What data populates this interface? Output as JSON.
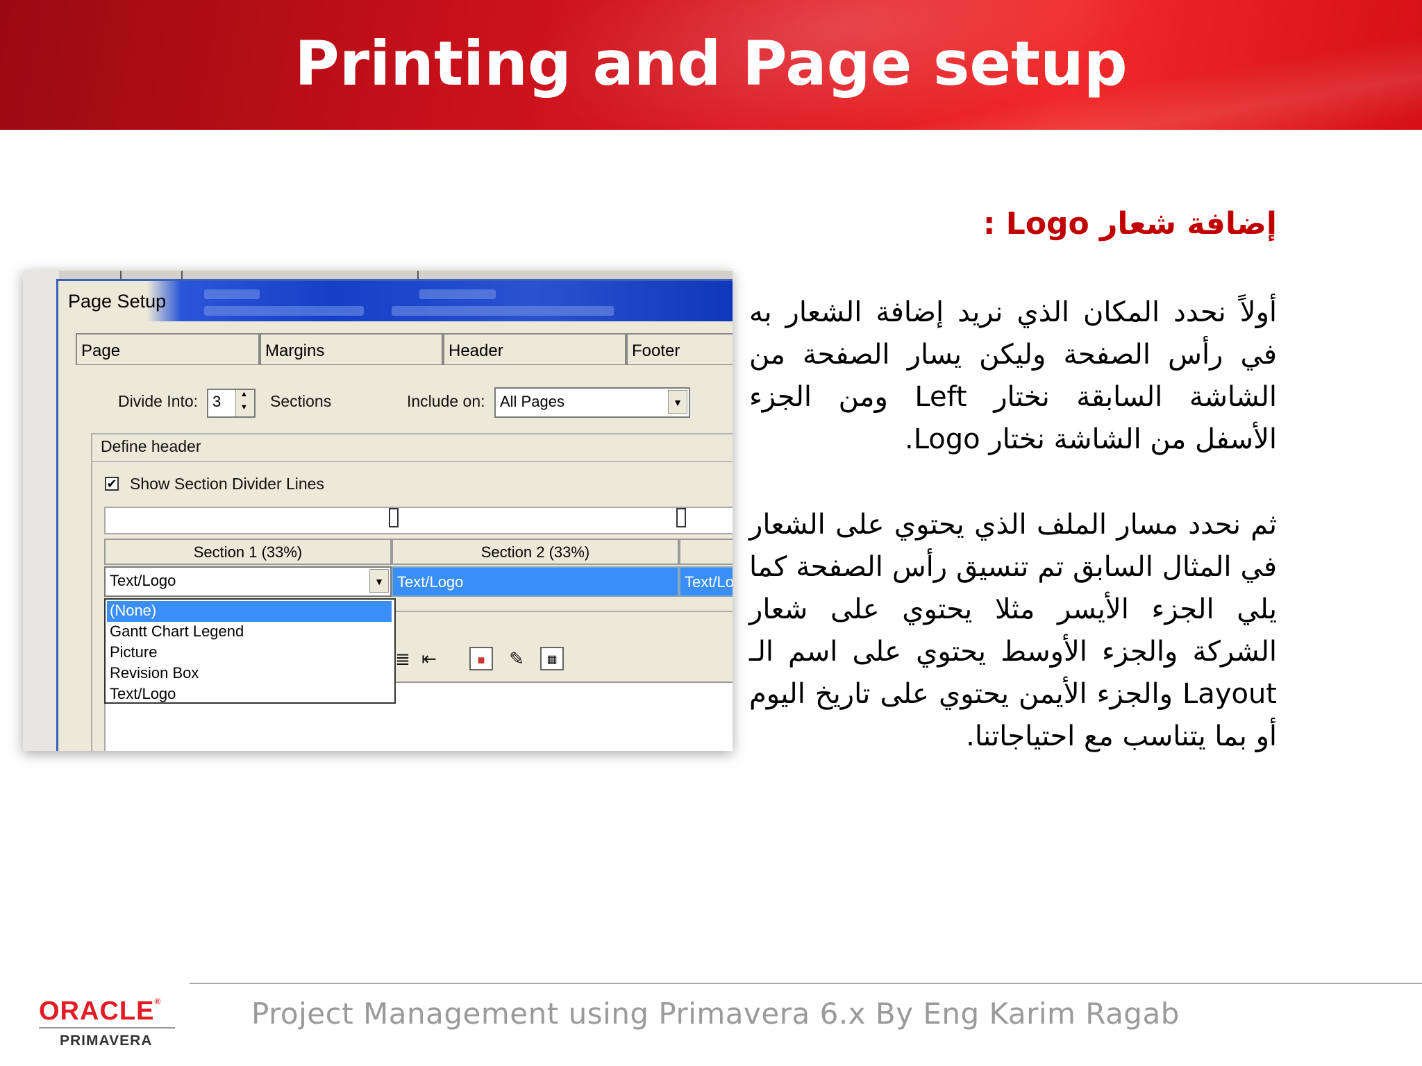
{
  "slide": {
    "title": "Printing and Page setup"
  },
  "arabic": {
    "heading": "إضافة شعار Logo :",
    "paragraph1": "أولاً نحدد المكان الذي نريد إضافة الشعار به في رأس الصفحة وليكن يسار الصفحة من الشاشة السابقة نختار Left ومن الجزء الأسفل من الشاشة نختار Logo.",
    "paragraph2": "ثم نحدد مسار الملف الذي يحتوي على الشعار في المثال السابق تم تنسيق رأس الصفحة كما يلي الجزء الأيسر مثلا يحتوي على شعار الشركة والجزء الأوسط يحتوي على اسم الـ Layout والجزء الأيمن يحتوي على تاريخ اليوم أو بما يتناسب مع احتياجاتنا."
  },
  "dialog": {
    "title": "Page Setup",
    "tabs": [
      "Page",
      "Margins",
      "Header",
      "Footer"
    ],
    "divide_label": "Divide Into:",
    "divide_value": "3",
    "sections_label": "Sections",
    "include_label": "Include on:",
    "include_value": "All Pages",
    "group_label": "Define header",
    "show_dividers_label": "Show Section Divider Lines",
    "show_dividers_checked": true,
    "section_headers": [
      "Section 1 (33%)",
      "Section 2 (33%)"
    ],
    "section_values": [
      "Text/Logo",
      "Text/Logo",
      "Text/Lo"
    ],
    "dropdown_options": [
      "(None)",
      "Gantt Chart Legend",
      "Picture",
      "Revision Box",
      "Text/Logo"
    ],
    "dropdown_selected": "(None)"
  },
  "footer": {
    "text": "Project Management using Primavera 6.x By Eng Karim Ragab",
    "logo_brand": "ORACLE",
    "logo_sub": "PRIMAVERA"
  },
  "colors": {
    "title_band": "#d0141c",
    "heading_red": "#c00000",
    "selection_blue": "#3a8ef8",
    "oracle_red": "#e31b23"
  }
}
